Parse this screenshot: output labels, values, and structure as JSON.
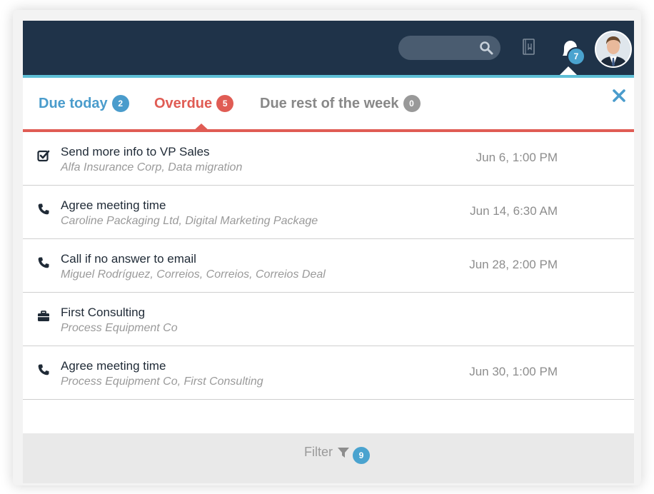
{
  "header": {
    "search_placeholder": "",
    "notifications_count": "7"
  },
  "tabs": [
    {
      "label": "Due today",
      "count": "2",
      "color": "#4a9ccc"
    },
    {
      "label": "Overdue",
      "count": "5",
      "color": "#e05c54"
    },
    {
      "label": "Due rest of the week",
      "count": "0",
      "color": "#888888"
    }
  ],
  "items": [
    {
      "icon": "checkbox-icon",
      "title": "Send more info to VP Sales",
      "subtitle": "Alfa Insurance Corp, Data migration",
      "when": "Jun 6, 1:00 PM"
    },
    {
      "icon": "phone-icon",
      "title": "Agree meeting time",
      "subtitle": "Caroline Packaging Ltd, Digital Marketing Package",
      "when": "Jun 14, 6:30 AM"
    },
    {
      "icon": "phone-icon",
      "title": "Call if no answer to email",
      "subtitle": "Miguel Rodríguez, Correios, Correios, Correios Deal",
      "when": "Jun 28, 2:00 PM"
    },
    {
      "icon": "briefcase-icon",
      "title": "First Consulting",
      "subtitle": "Process Equipment Co",
      "when": ""
    },
    {
      "icon": "phone-icon",
      "title": "Agree meeting time",
      "subtitle": "Process Equipment Co, First Consulting",
      "when": "Jun 30, 1:00 PM"
    }
  ],
  "footer": {
    "filter_label": "Filter",
    "filter_count": "9"
  },
  "colors": {
    "topbar": "#1f3349",
    "accent_blue": "#4a9ccc",
    "accent_red": "#e05c54"
  }
}
